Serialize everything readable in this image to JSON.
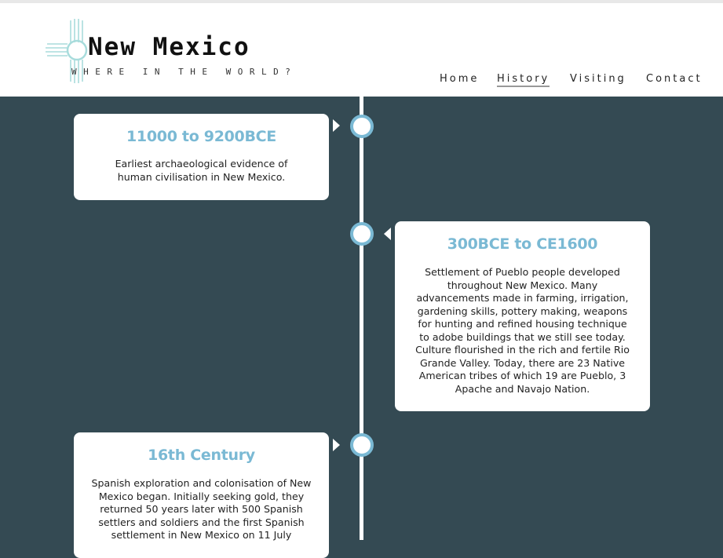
{
  "site": {
    "title": "New Mexico",
    "tagline": "WHERE IN THE WORLD?"
  },
  "nav": {
    "items": [
      {
        "label": "Home"
      },
      {
        "label": "History"
      },
      {
        "label": "Visiting"
      },
      {
        "label": "Contact"
      }
    ],
    "active": "History"
  },
  "timeline": {
    "events": [
      {
        "title": "11000 to 9200BCE",
        "text": "Earliest archaeological evidence of human civilisation in New Mexico."
      },
      {
        "title": "300BCE to CE1600",
        "text": "Settlement of Pueblo people developed throughout New Mexico. Many advancements made in farming, irrigation, gardening skills, pottery making, weapons for hunting and refined housing technique to adobe buildings that we still see today. Culture flourished in the rich and fertile Rio Grande Valley. Today, there are 23 Native American tribes of which 19 are Pueblo, 3 Apache and Navajo Nation."
      },
      {
        "title": "16th Century",
        "text": "Spanish exploration and colonisation of New Mexico began. Initially seeking gold, they returned 50 years later with 500 Spanish settlers and soldiers and the first Spanish settlement in New Mexico on 11 July"
      }
    ]
  },
  "colors": {
    "background": "#344a53",
    "accent": "#7ab9d4",
    "header": "#ffffff"
  },
  "icons": {
    "logo": "zia-sun-symbol-icon"
  }
}
